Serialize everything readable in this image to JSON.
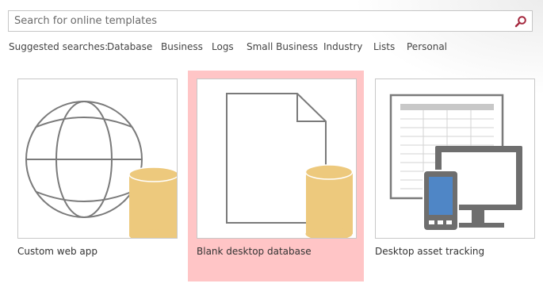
{
  "search": {
    "placeholder": "Search for online templates",
    "value": "",
    "icon": "magnifier-icon",
    "icon_color": "#a4263c"
  },
  "suggested": {
    "label": "Suggested searches:",
    "links": [
      "Database",
      "Business",
      "Logs",
      "Small Business",
      "Industry",
      "Lists",
      "Personal"
    ]
  },
  "templates": [
    {
      "label": "Custom web app",
      "icon": "globe-database-icon",
      "selected": false
    },
    {
      "label": "Blank desktop database",
      "icon": "blank-document-database-icon",
      "selected": true
    },
    {
      "label": "Desktop asset tracking",
      "icon": "spreadsheet-devices-icon",
      "selected": false
    }
  ],
  "colors": {
    "selected_tile": "#ffc5c6",
    "database_cylinder": "#edc97d",
    "line_art": "#7a7a7a",
    "device_screen": "#4f86c6"
  }
}
